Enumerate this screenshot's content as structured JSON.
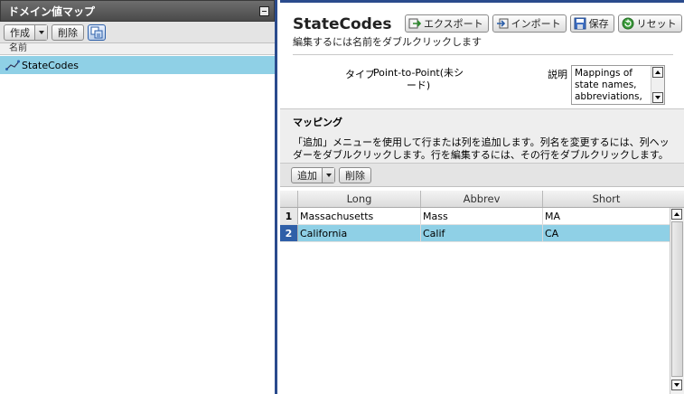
{
  "left_panel": {
    "title": "ドメイン値マップ",
    "toolbar": {
      "create_label": "作成",
      "delete_label": "削除"
    },
    "column_header": "名前",
    "items": [
      {
        "label": "StateCodes",
        "selected": true
      }
    ]
  },
  "detail": {
    "title": "StateCodes",
    "hint": "編集するには名前をダブルクリックします",
    "buttons": {
      "export": "エクスポート",
      "import": "インポート",
      "save": "保存",
      "reset": "リセット"
    },
    "type_label": "タイプ",
    "type_value": "Point-to-Point(未シード)",
    "description_label": "説明",
    "description_value": "Mappings of state names, abbreviations,"
  },
  "mapping": {
    "title": "マッピング",
    "description": "「追加」メニューを使用して行または列を追加します。列名を変更するには、列ヘッダーをダブルクリックします。行を編集するには、その行をダブルクリックします。",
    "toolbar": {
      "add_label": "追加",
      "delete_label": "削除"
    },
    "columns": [
      "Long",
      "Abbrev",
      "Short"
    ],
    "rows": [
      {
        "num": "1",
        "cells": [
          "Massachusetts",
          "Mass",
          "MA"
        ]
      },
      {
        "num": "2",
        "cells": [
          "California",
          "Calif",
          "CA"
        ]
      }
    ]
  },
  "colors": {
    "selection": "#8fd0e6",
    "header_dark": "#4a4a4a",
    "accent_border": "#2a4b8d"
  }
}
